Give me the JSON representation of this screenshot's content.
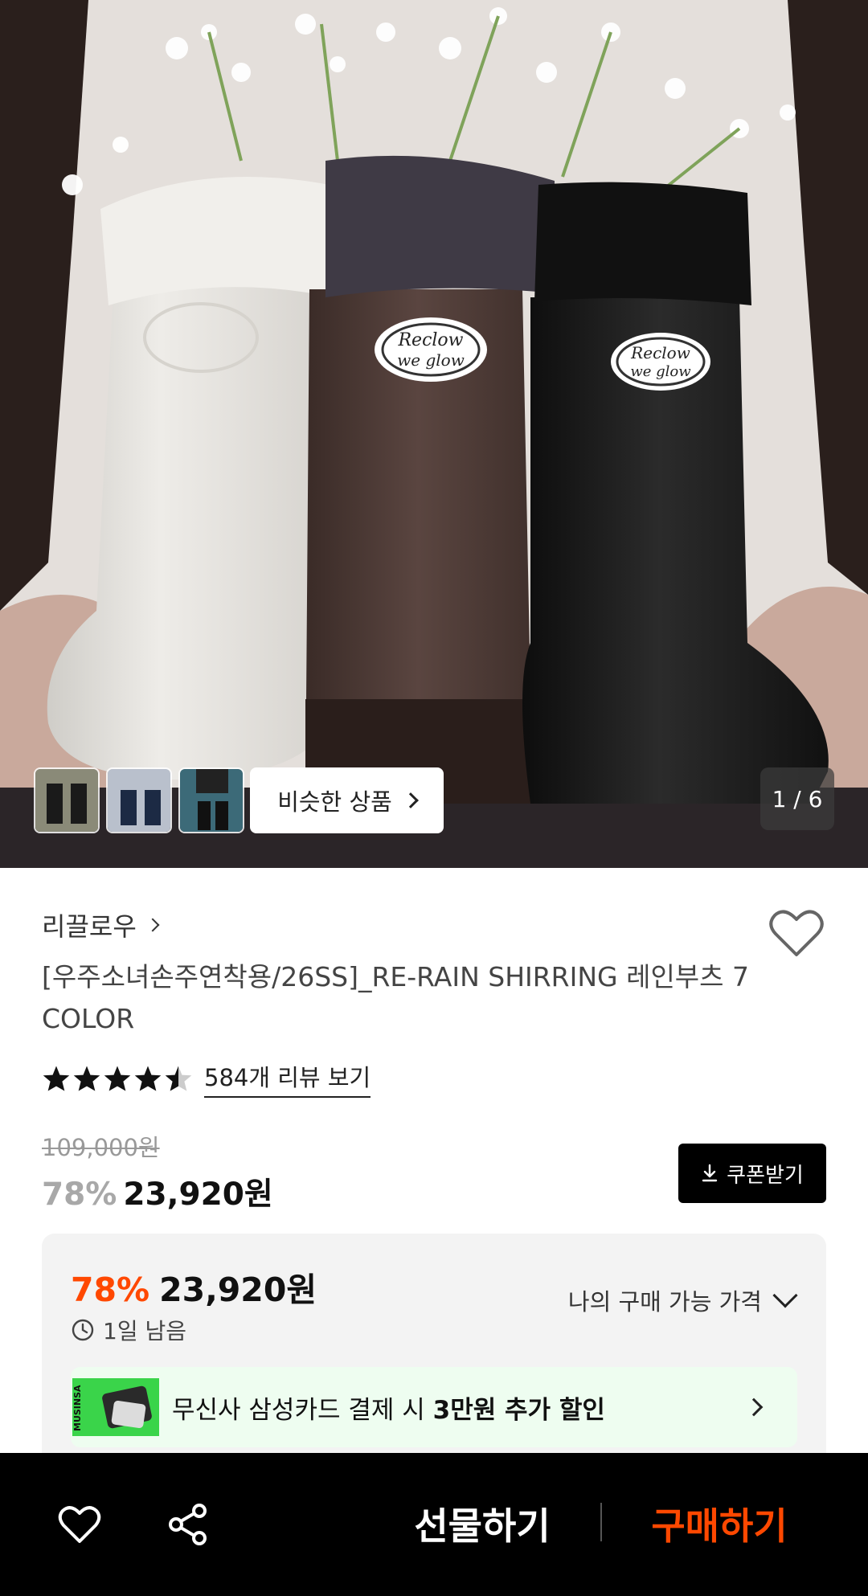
{
  "gallery": {
    "similar_label": "비슷한 상품",
    "counter": "1 / 6",
    "logo_text_line1": "Reclow",
    "logo_text_line2": "we glow"
  },
  "product": {
    "brand": "리끌로우",
    "title": "[우주소녀손주연착용/26SS]_RE-RAIN SHIRRING 레인부츠 7 COLOR",
    "rating": 4.5,
    "review_link": "584개 리뷰 보기",
    "original_price": "109,000원",
    "discount_rate": "78%",
    "sale_price": "23,920원",
    "coupon_label": "쿠폰받기"
  },
  "benefit": {
    "discount_rate": "78%",
    "price": "23,920원",
    "time_left": "1일 남음",
    "my_price_label": "나의 구매 가능 가격",
    "card_text_prefix": "무신사 삼성카드 결제 시 ",
    "card_text_bold": "3만원 추가 할인",
    "card_brand": "MUSINSA"
  },
  "bottom_bar": {
    "gift_label": "선물하기",
    "buy_label": "구매하기"
  },
  "colors": {
    "accent": "#ff4800",
    "bar_bg": "#000000",
    "promo_bg": "#eefdf0",
    "box_bg": "#f3f3f3"
  }
}
